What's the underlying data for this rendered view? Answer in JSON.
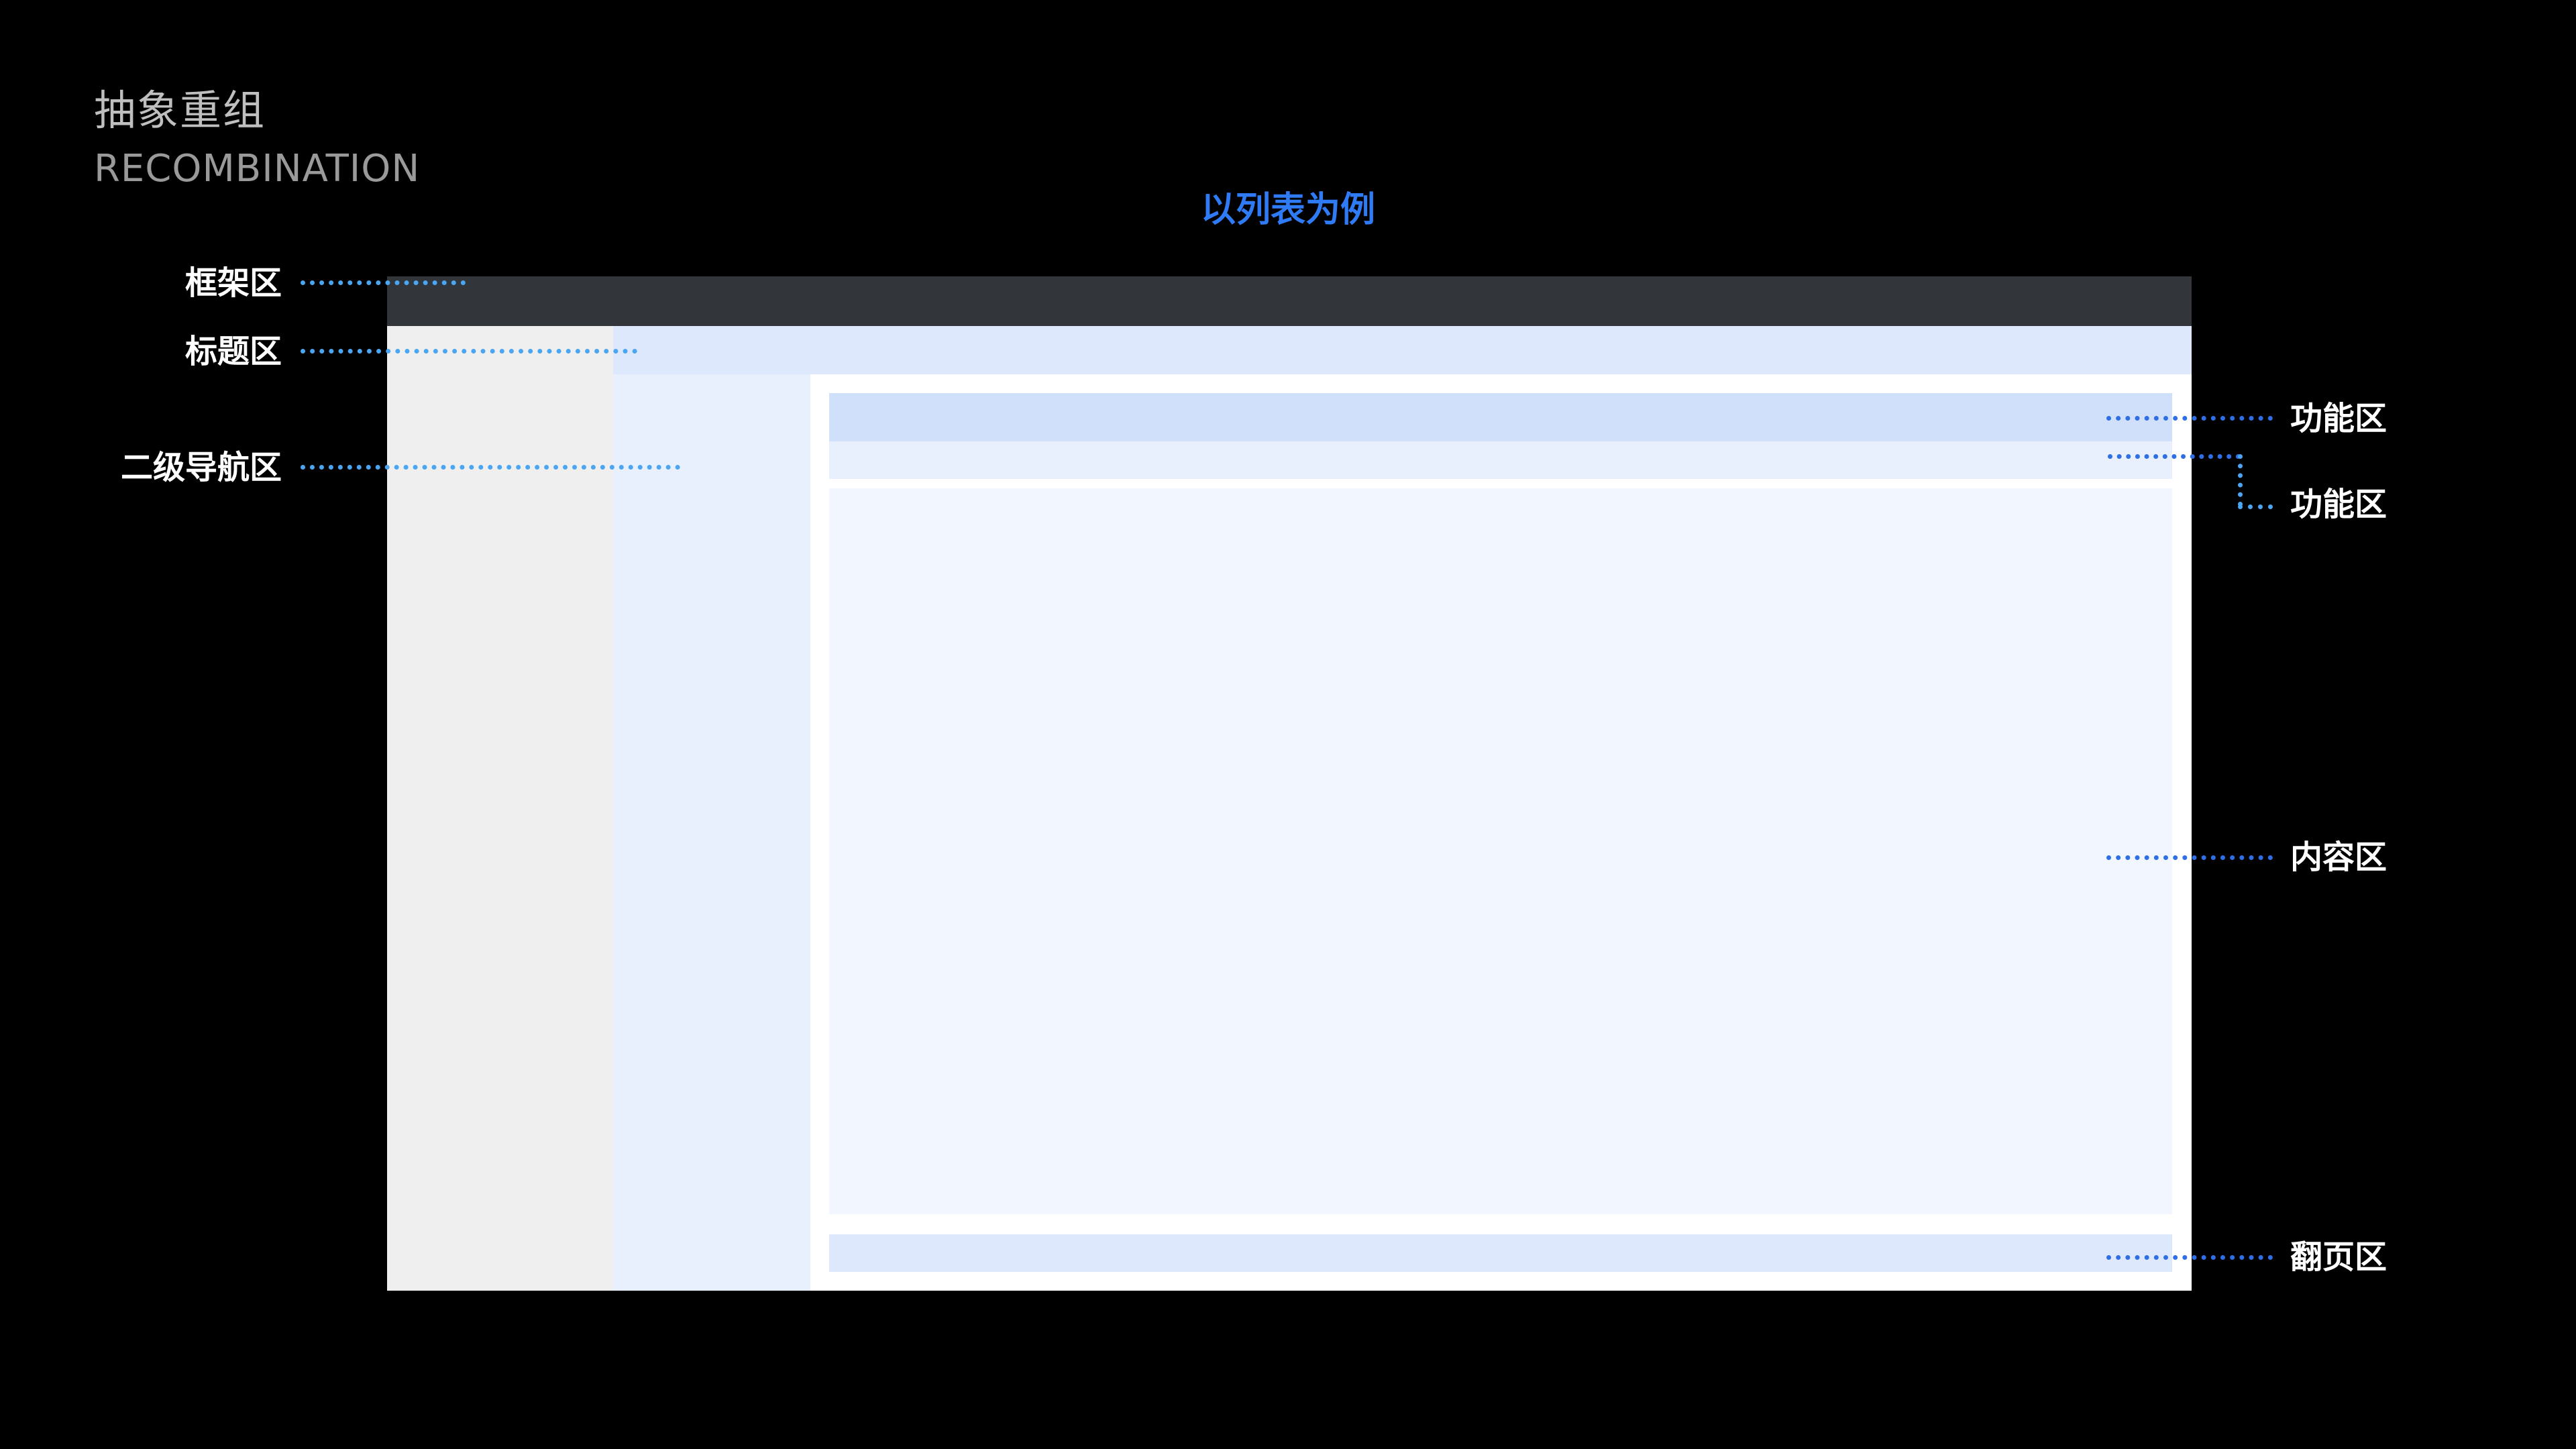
{
  "header": {
    "title_cn": "抽象重组",
    "title_en": "RECOMBINATION",
    "subtitle": "以列表为例"
  },
  "labels": {
    "frame": "框架区",
    "title": "标题区",
    "secondary_nav": "二级导航区",
    "function_1": "功能区",
    "function_2": "功能区",
    "content": "内容区",
    "pagination": "翻页区"
  },
  "colors": {
    "background": "#000000",
    "accent": "#2f7bf5",
    "leader_light": "#4aa6f2",
    "leader_deep": "#2f6fe6",
    "frame_bar": "#32353a",
    "left_column": "#efefef",
    "title_band": "#dde8fc",
    "secondary_nav": "#e9f0fd",
    "function_bar": "#d0dffa",
    "content_block": "#f2f6fe"
  }
}
